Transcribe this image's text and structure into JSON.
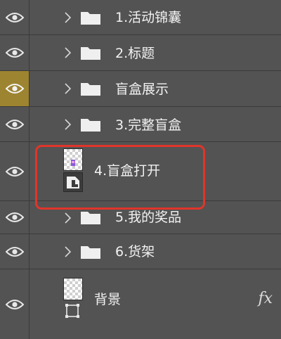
{
  "layers": [
    {
      "name": "1.活动锦囊",
      "type": "group"
    },
    {
      "name": "2.标题",
      "type": "group"
    },
    {
      "name": "盲盒展示",
      "type": "group",
      "eye_highlight": true
    },
    {
      "name": "3.完整盲盒",
      "type": "group"
    },
    {
      "name": "4.盲盒打开",
      "type": "smart-object"
    },
    {
      "name": "5.我的奖品",
      "type": "group"
    },
    {
      "name": "6.货架",
      "type": "group"
    },
    {
      "name": "背景",
      "type": "layer",
      "fx": "fx"
    }
  ],
  "colors": {
    "panel_bg": "#535353",
    "eye_highlight": "#9d8430",
    "annotation": "#e0352b"
  },
  "icons": {
    "visibility": "eye-icon",
    "expand": "chevron-right-icon",
    "group": "folder-icon"
  }
}
